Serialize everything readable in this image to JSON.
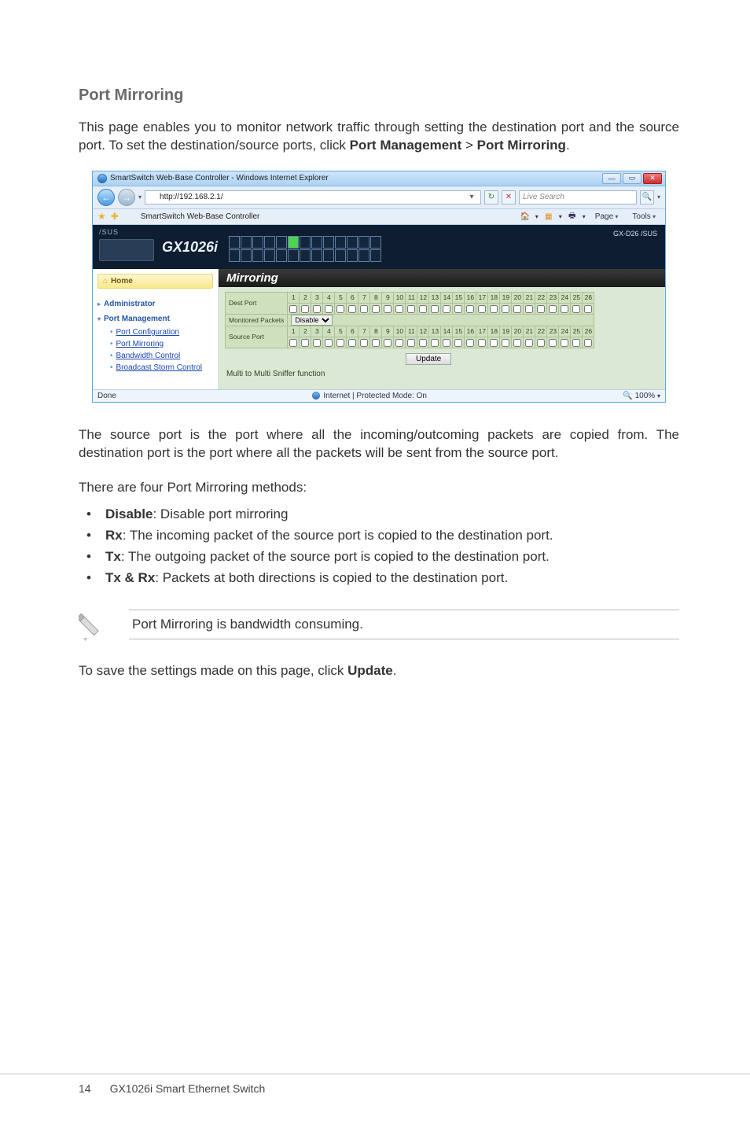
{
  "section_title": "Port Mirroring",
  "intro_pre": "This page enables you to monitor network traffic through setting the destination port and the source port. To set the destination/source ports, click ",
  "intro_b1": "Port Management",
  "intro_gt": " > ",
  "intro_b2": "Port Mirroring",
  "intro_post": ".",
  "shot": {
    "window_title": "SmartSwitch Web-Base Controller - Windows Internet Explorer",
    "url": "http://192.168.2.1/",
    "search_placeholder": "Live Search",
    "tab_title": "SmartSwitch Web-Base Controller",
    "toolbar": {
      "page": "Page",
      "tools": "Tools"
    },
    "brand_small": "/SUS",
    "model": "GX1026i",
    "right_badge": "GX-D26 /SUS",
    "home": "Home",
    "nav": {
      "admin": "Administrator",
      "pm": "Port Management",
      "items": [
        "Port Configuration",
        "Port Mirroring",
        "Bandwidth Control",
        "Broadcast Storm Control"
      ]
    },
    "panel_title": "Mirroring",
    "rows": {
      "dest": "Dest Port",
      "monitored": "Monitored Packets",
      "disable_opt": "Disable",
      "source": "Source Port"
    },
    "update": "Update",
    "multi": "Multi to Multi Sniffer function",
    "status_done": "Done",
    "status_mode": "Internet | Protected Mode: On",
    "zoom": "100%"
  },
  "para2": "The source port is the port where all the incoming/outcoming packets are copied from. The destination port is the port where all the packets will be sent from the source port.",
  "methods_lead": "There are four Port Mirroring methods:",
  "methods": [
    {
      "b": "Disable",
      "t": ": Disable port mirroring"
    },
    {
      "b": "Rx",
      "t": ": The incoming packet of the source port is copied to the destination port."
    },
    {
      "b": "Tx",
      "t": ": The outgoing packet of the source port is copied to the destination port."
    },
    {
      "b": "Tx & Rx",
      "t": ": Packets at both directions is copied to the destination port."
    }
  ],
  "note": "Port Mirroring is bandwidth consuming.",
  "save_pre": "To save the settings made on this page, click ",
  "save_b": "Update",
  "save_post": ".",
  "footer": {
    "page": "14",
    "product": "GX1026i Smart Ethernet Switch"
  },
  "chart_data": {
    "type": "table",
    "title": "Mirroring port matrix",
    "columns_range": [
      1,
      26
    ],
    "rows": [
      {
        "label": "Dest Port",
        "cells": "26 unchecked checkboxes (ports 1–26)"
      },
      {
        "label": "Monitored Packets",
        "value": "Disable",
        "control": "dropdown"
      },
      {
        "label": "Source Port",
        "cells": "26 unchecked checkboxes (ports 1–26)"
      }
    ]
  }
}
